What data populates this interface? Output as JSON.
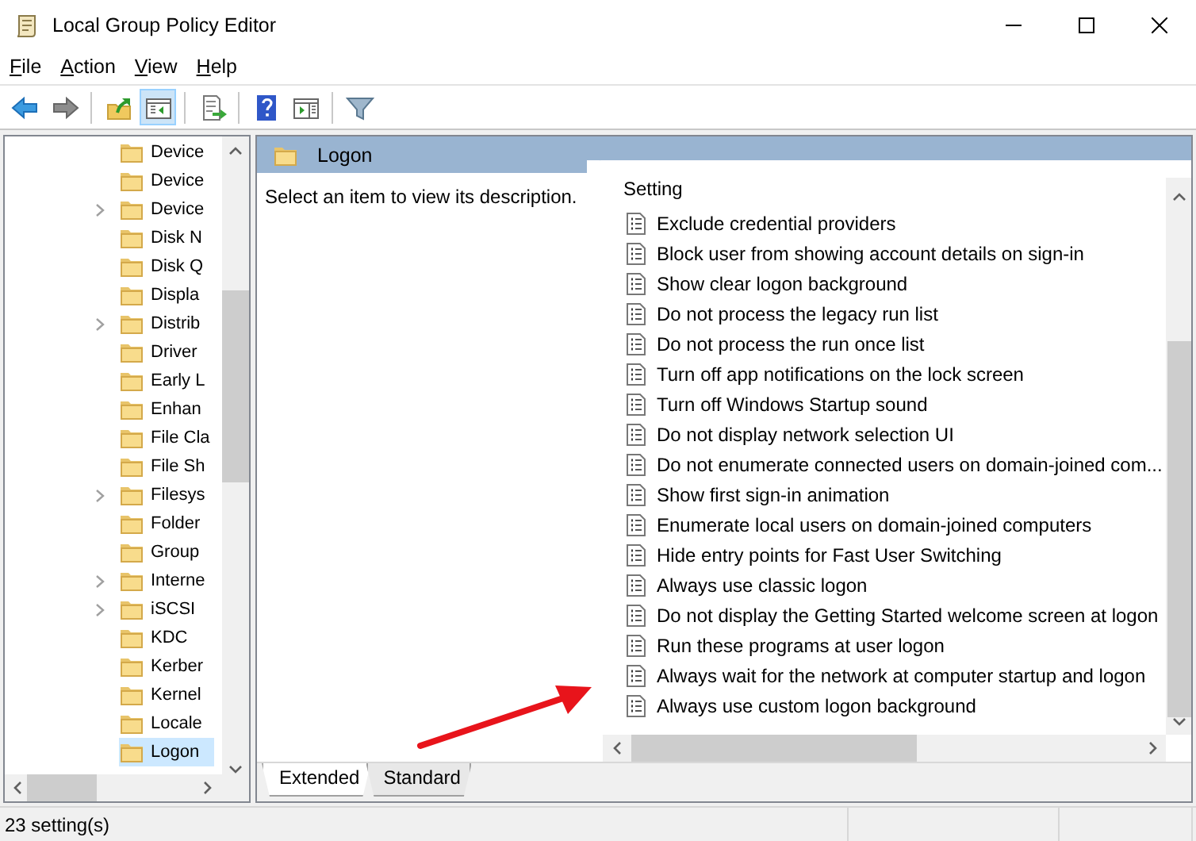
{
  "window": {
    "title": "Local Group Policy Editor"
  },
  "menu": [
    {
      "label": "File"
    },
    {
      "label": "Action"
    },
    {
      "label": "View"
    },
    {
      "label": "Help"
    }
  ],
  "toolbar": [
    {
      "kind": "back",
      "pressed": false
    },
    {
      "kind": "forward",
      "pressed": false
    },
    {
      "kind": "separator"
    },
    {
      "kind": "up",
      "pressed": false
    },
    {
      "kind": "tree",
      "pressed": true
    },
    {
      "kind": "separator"
    },
    {
      "kind": "export",
      "pressed": false
    },
    {
      "kind": "separator"
    },
    {
      "kind": "help",
      "pressed": false
    },
    {
      "kind": "show",
      "pressed": false
    },
    {
      "kind": "separator"
    },
    {
      "kind": "filter",
      "pressed": false
    }
  ],
  "tree": {
    "items": [
      {
        "label": "Device",
        "expandable": false,
        "selected": false
      },
      {
        "label": "Device",
        "expandable": false,
        "selected": false
      },
      {
        "label": "Device",
        "expandable": true,
        "selected": false
      },
      {
        "label": "Disk N",
        "expandable": false,
        "selected": false
      },
      {
        "label": "Disk Q",
        "expandable": false,
        "selected": false
      },
      {
        "label": "Displa",
        "expandable": false,
        "selected": false
      },
      {
        "label": "Distrib",
        "expandable": true,
        "selected": false
      },
      {
        "label": "Driver",
        "expandable": false,
        "selected": false
      },
      {
        "label": "Early L",
        "expandable": false,
        "selected": false
      },
      {
        "label": "Enhan",
        "expandable": false,
        "selected": false
      },
      {
        "label": "File Cla",
        "expandable": false,
        "selected": false
      },
      {
        "label": "File Sh",
        "expandable": false,
        "selected": false
      },
      {
        "label": "Filesys",
        "expandable": true,
        "selected": false
      },
      {
        "label": "Folder",
        "expandable": false,
        "selected": false
      },
      {
        "label": "Group",
        "expandable": false,
        "selected": false
      },
      {
        "label": "Interne",
        "expandable": true,
        "selected": false
      },
      {
        "label": "iSCSI",
        "expandable": true,
        "selected": false
      },
      {
        "label": "KDC",
        "expandable": false,
        "selected": false
      },
      {
        "label": "Kerber",
        "expandable": false,
        "selected": false
      },
      {
        "label": "Kernel",
        "expandable": false,
        "selected": false
      },
      {
        "label": "Locale",
        "expandable": false,
        "selected": false
      },
      {
        "label": "Logon",
        "expandable": false,
        "selected": true
      }
    ]
  },
  "details": {
    "header": "Logon",
    "description": "Select an item to view its description.",
    "column": "Setting",
    "settings": [
      {
        "label": "Exclude credential providers"
      },
      {
        "label": "Block user from showing account details on sign-in"
      },
      {
        "label": "Show clear logon background"
      },
      {
        "label": "Do not process the legacy run list"
      },
      {
        "label": "Do not process the run once list"
      },
      {
        "label": "Turn off app notifications on the lock screen"
      },
      {
        "label": "Turn off Windows Startup sound"
      },
      {
        "label": "Do not display network selection UI"
      },
      {
        "label": "Do not enumerate connected users on domain-joined com..."
      },
      {
        "label": "Show first sign-in animation"
      },
      {
        "label": "Enumerate local users on domain-joined computers"
      },
      {
        "label": "Hide entry points for Fast User Switching"
      },
      {
        "label": "Always use classic logon"
      },
      {
        "label": "Do not display the Getting Started welcome screen at logon"
      },
      {
        "label": "Run these programs at user logon"
      },
      {
        "label": "Always wait for the network at computer startup and logon"
      },
      {
        "label": "Always use custom logon background"
      }
    ],
    "tabs": [
      {
        "label": "Extended",
        "selected": true
      },
      {
        "label": "Standard",
        "selected": false
      }
    ]
  },
  "status_bar": {
    "text": "23 setting(s)"
  }
}
